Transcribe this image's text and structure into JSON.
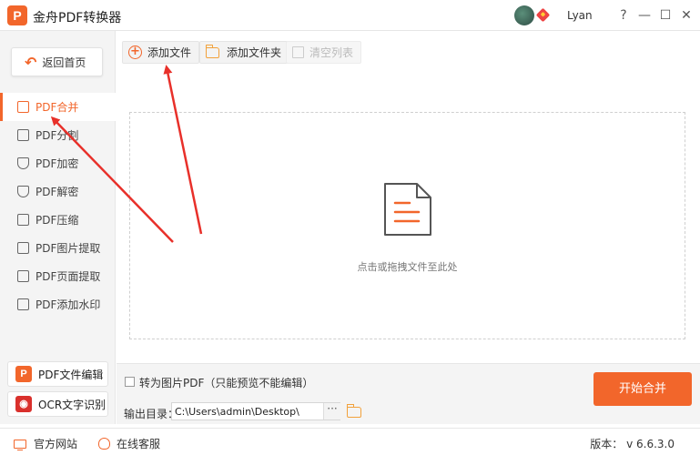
{
  "app": {
    "title": "金舟PDF转换器",
    "logo_letter": "P"
  },
  "user": {
    "name": "Lyan"
  },
  "window": {
    "help": "?",
    "minimize": "—",
    "maximize": "☐",
    "close": "✕"
  },
  "sidebar": {
    "home_label": "返回首页",
    "items": [
      {
        "label": "PDF合并",
        "active": true
      },
      {
        "label": "PDF分割"
      },
      {
        "label": "PDF加密"
      },
      {
        "label": "PDF解密"
      },
      {
        "label": "PDF压缩"
      },
      {
        "label": "PDF图片提取"
      },
      {
        "label": "PDF页面提取"
      },
      {
        "label": "PDF添加水印"
      }
    ],
    "tools": [
      {
        "label": "PDF文件编辑",
        "icon": "pdf-editor-icon",
        "letter": "P",
        "color": "#f2662b"
      },
      {
        "label": "OCR文字识别",
        "icon": "ocr-eye-icon",
        "letter": "◉",
        "color": "#d9302c"
      }
    ]
  },
  "toolbar": {
    "add_file": "添加文件",
    "add_folder": "添加文件夹",
    "clear_list": "清空列表"
  },
  "dropzone": {
    "hint": "点击或拖拽文件至此处"
  },
  "options": {
    "to_image_label": "转为图片PDF（只能预览不能编辑）",
    "output_label": "输出目录：",
    "output_path": "C:\\Users\\admin\\Desktop\\",
    "browse": "···",
    "start_button": "开始合并"
  },
  "status": {
    "website": "官方网站",
    "service": "在线客服",
    "version": "版本： v 6.6.3.0"
  },
  "colors": {
    "accent": "#f2662b",
    "annotation": "#e8302a"
  }
}
